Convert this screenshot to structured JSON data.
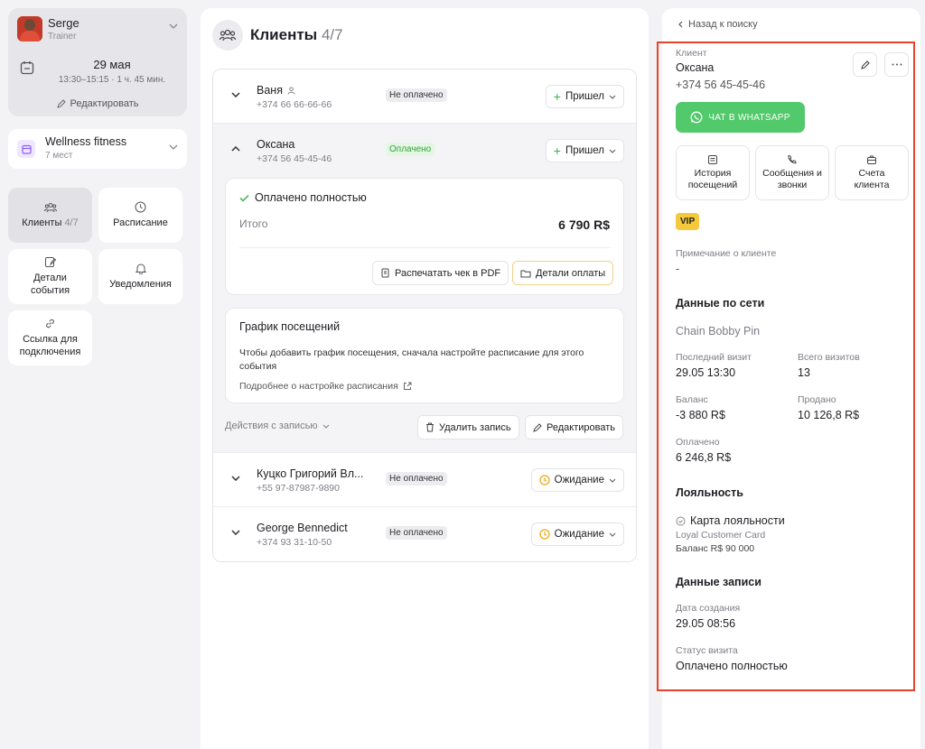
{
  "user": {
    "name": "Serge",
    "role": "Trainer",
    "date": "29 мая",
    "time": "13:30–15:15 · 1 ч. 45 мин.",
    "edit_label": "Редактировать"
  },
  "gym": {
    "name": "Wellness fitness",
    "sub": "7 мест"
  },
  "nav": {
    "clients_label": "Клиенты",
    "clients_count": "4/7",
    "schedule_label": "Расписание",
    "event_details_label": "Детали события",
    "notifications_label": "Уведомления",
    "link_label": "Ссылка для подключения"
  },
  "clients_panel": {
    "title": "Клиенты",
    "count": "4/7",
    "rows": [
      {
        "name": "Ваня",
        "phone": "+374 66 66-66-66",
        "badge": "Не оплачено",
        "status": "Пришел"
      },
      {
        "name": "Оксана",
        "phone": "+374 56 45-45-46",
        "badge": "Оплачено",
        "status": "Пришел"
      },
      {
        "name": "Куцко Григорий Вл...",
        "phone": "+55 97-87987-9890",
        "badge": "Не оплачено",
        "status": "Ожидание"
      },
      {
        "name": "George Bennedict",
        "phone": "+374 93 31-10-50",
        "badge": "Не оплачено",
        "status": "Ожидание"
      }
    ],
    "payment": {
      "title": "Оплачено полностью",
      "total_label": "Итого",
      "total_value": "6 790 R$",
      "print_btn": "Распечатать чек в PDF",
      "details_btn": "Детали оплаты"
    },
    "schedule": {
      "title": "График посещений",
      "text": "Чтобы добавить график посещения, сначала настройте расписание для этого события",
      "link": "Подробнее о настройке расписания"
    },
    "actions": {
      "label": "Действия с записью",
      "delete_btn": "Удалить запись",
      "edit_btn": "Редактировать"
    }
  },
  "client_card": {
    "back": "Назад к поиску",
    "client_label": "Клиент",
    "name": "Оксана",
    "phone": "+374 56 45-45-46",
    "whatsapp_btn": "ЧАТ В WHATSAPP",
    "tiles": [
      "История посещений",
      "Сообщения и звонки",
      "Счета клиента"
    ],
    "vip": "VIP",
    "note_label": "Примечание о клиенте",
    "note_value": "-",
    "network_title": "Данные по сети",
    "network_name": "Chain Bobby Pin",
    "last_visit_label": "Последний визит",
    "last_visit": "29.05 13:30",
    "total_visits_label": "Всего визитов",
    "total_visits": "13",
    "balance_label": "Баланс",
    "balance": "-3 880 R$",
    "sold_label": "Продано",
    "sold": "10 126,8 R$",
    "paid_label": "Оплачено",
    "paid": "6 246,8 R$",
    "loyalty_title": "Лояльность",
    "loyalty_card": "Карта лояльности",
    "loyalty_sub": "Loyal Customer Card",
    "loyalty_balance": "Баланс R$ 90 000",
    "record_title": "Данные записи",
    "created_label": "Дата создания",
    "created": "29.05 08:56",
    "visit_status_label": "Статус визита",
    "visit_status": "Оплачено полностью"
  },
  "colors": {
    "accent_green": "#52c96b",
    "highlight_frame": "#e5442b",
    "vip": "#f5c93c"
  }
}
